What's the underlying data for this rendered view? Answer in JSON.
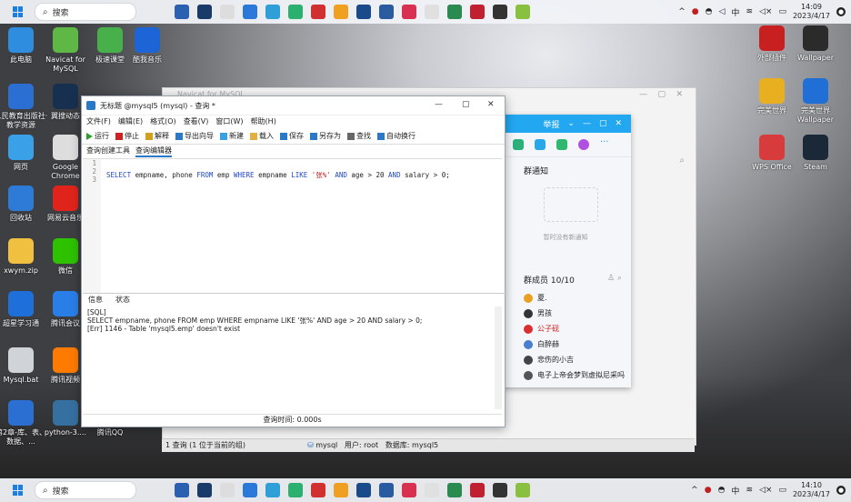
{
  "taskbar": {
    "search_placeholder": "搜索",
    "clock_top": {
      "time": "14:09",
      "date": "2023/4/17"
    },
    "clock_bottom": {
      "time": "14:10",
      "date": "2023/4/17"
    },
    "tray_icons": [
      "chevron-up-icon",
      "app-icon",
      "app-icon",
      "send-icon",
      "ime-icon",
      "wifi-icon",
      "volume-icon",
      "battery-icon"
    ],
    "ime_label": "中"
  },
  "desktop": {
    "left_icons": [
      {
        "label": "此电脑",
        "color": "#2f8de0"
      },
      {
        "label": "Navicat for MySQL",
        "color": "#5fb846"
      },
      {
        "label": "极速课堂",
        "color": "#48b04a"
      },
      {
        "label": "酷我音乐",
        "color": "#1d64d6"
      },
      {
        "label": "人民教育出版社·教学资源",
        "color": "#2b6fd2"
      },
      {
        "label": "翼搜动态",
        "color": "#18304f"
      },
      {
        "label": "网页",
        "color": "#3aa0e8"
      },
      {
        "label": "Google Chrome",
        "color": "#dddddd"
      },
      {
        "label": "回收站",
        "color": "#2d7bd6"
      },
      {
        "label": "网易云音乐",
        "color": "#e0241c"
      },
      {
        "label": "xwym.zip",
        "color": "#f0c040"
      },
      {
        "label": "微信",
        "color": "#2dc100"
      },
      {
        "label": "超星学习通",
        "color": "#1e6fd9"
      },
      {
        "label": "腾讯会议",
        "color": "#2a7ee8"
      },
      {
        "label": "Mysql.bat",
        "color": "#d0d4d8"
      },
      {
        "label": "腾讯视频",
        "color": "#ff7a00"
      },
      {
        "label": "第2章-库、表、数据、...",
        "color": "#2b6fd2"
      },
      {
        "label": "python-3....",
        "color": "#3670a0"
      },
      {
        "label": "腾讯QQ",
        "color": "#1aa2ee"
      }
    ],
    "right_icons": [
      {
        "label": "外部插件",
        "color": "#c82020"
      },
      {
        "label": "Wallpaper",
        "color": "#2b2b2b"
      },
      {
        "label": "完美世界",
        "color": "#e8b020"
      },
      {
        "label": "完美世界 Wallpaper",
        "color": "#1f6fd6"
      },
      {
        "label": "WPS Office",
        "color": "#d83b3b"
      },
      {
        "label": "Steam",
        "color": "#1b2838"
      }
    ]
  },
  "bg_navicat": {
    "title": "Navicat for MySQL",
    "status_left": "1 查询 (1 位于当前的组)",
    "status_right": {
      "conn": "mysql",
      "user_label": "用户: root",
      "db_label": "数据库: mysql5"
    }
  },
  "qq": {
    "header_text": "举报",
    "group_notice_title": "群通知",
    "group_notice_empty": "暂时没有新通知",
    "members_title": "群成员 10/10",
    "members": [
      {
        "name": "夏.",
        "color": "#e8a020"
      },
      {
        "name": "男孩",
        "color": "#333333"
      },
      {
        "name": "公子砚",
        "color": "#d83030"
      },
      {
        "name": "白醉赫",
        "color": "#4a7fd0"
      },
      {
        "name": "悲伤的小吉",
        "color": "#444444"
      },
      {
        "name": "电子上帝会梦到虚拟尼采吗",
        "color": "#555555"
      }
    ]
  },
  "query_window": {
    "title": "无标题 @mysql5 (mysql) - 查询 *",
    "menus": [
      "文件(F)",
      "编辑(E)",
      "格式(O)",
      "查看(V)",
      "窗口(W)",
      "帮助(H)"
    ],
    "tools": [
      {
        "label": "运行",
        "color": "#2ba02b"
      },
      {
        "label": "停止",
        "color": "#d02020"
      },
      {
        "label": "解释",
        "color": "#d0a020"
      },
      {
        "label": "导出向导",
        "color": "#2a78c8"
      },
      {
        "label": "新建",
        "color": "#3aa0e0"
      },
      {
        "label": "载入",
        "color": "#e0b040"
      },
      {
        "label": "保存",
        "color": "#2a78c8"
      },
      {
        "label": "另存为",
        "color": "#2a78c8"
      },
      {
        "label": "查找",
        "color": "#666666"
      },
      {
        "label": "自动换行",
        "color": "#2a78c8"
      }
    ],
    "editor_tabs": [
      "查询创建工具",
      "查询编辑器"
    ],
    "line_numbers": [
      "1",
      "2",
      "3"
    ],
    "sql": {
      "k1": "SELECT",
      "t1": " empname, phone ",
      "k2": "FROM",
      "t2": " emp ",
      "k3": "WHERE",
      "t3": " empname ",
      "k4": "LIKE",
      "t4": " ",
      "s1": "'张%'",
      "t5": " ",
      "k5": "AND",
      "t6": " age > 20 ",
      "k6": "AND",
      "t7": " salary > 0;"
    },
    "info_tabs": [
      "信息",
      "状态"
    ],
    "messages": [
      "[SQL]",
      "SELECT empname, phone FROM emp WHERE empname LIKE '张%' AND age > 20 AND salary > 0;",
      "[Err] 1146 - Table 'mysql5.emp' doesn't exist"
    ],
    "status": "查询时间: 0.000s"
  }
}
